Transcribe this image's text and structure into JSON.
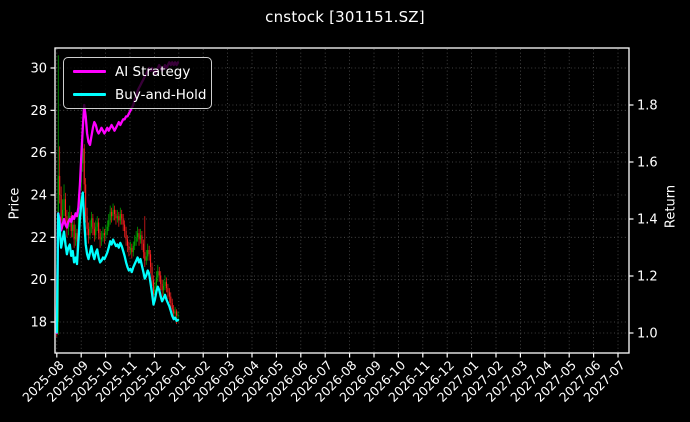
{
  "chart_data": {
    "type": "candlestick_with_lines",
    "title": "cnstock [301151.SZ]",
    "x_axis": {
      "tick_labels": [
        "2025-08",
        "2025-09",
        "2025-10",
        "2025-11",
        "2025-12",
        "2026-01",
        "2026-02",
        "2026-03",
        "2026-04",
        "2026-05",
        "2026-06",
        "2026-07",
        "2026-08",
        "2026-09",
        "2026-10",
        "2026-11",
        "2026-12",
        "2027-01",
        "2027-02",
        "2027-03",
        "2027-04",
        "2027-05",
        "2027-06",
        "2027-07"
      ],
      "label_rotation_deg": 45,
      "data_span": [
        "2025-08",
        "2026-01"
      ]
    },
    "y_left": {
      "label": "Price",
      "ticks": [
        30,
        28,
        26,
        24,
        22,
        20,
        18
      ],
      "range_approx": [
        16.5,
        31.0
      ]
    },
    "y_right": {
      "label": "Return",
      "ticks": [
        "1.8",
        "1.6",
        "1.4",
        "1.2",
        "1.0"
      ],
      "tick_values": [
        1.8,
        1.6,
        1.4,
        1.2,
        1.0
      ],
      "range_approx": [
        0.93,
        2.01
      ]
    },
    "legend": {
      "position": "upper-left",
      "items": [
        {
          "label": "AI Strategy",
          "color": "#ff00ff"
        },
        {
          "label": "Buy-and-Hold",
          "color": "#00ffff"
        }
      ]
    },
    "grid": true,
    "colors": {
      "background": "#000000",
      "text": "#ffffff",
      "spine": "#ffffff",
      "grid": "#999999",
      "candle_up": "#00b000",
      "candle_down": "#ff2020",
      "ai_line": "#ff00ff",
      "bh_line": "#00ffff"
    },
    "bh_base_price": 17.55,
    "candles_ohlc": [
      [
        17.8,
        18.1,
        17.3,
        17.6
      ],
      [
        18.0,
        30.6,
        17.4,
        24.9
      ],
      [
        24.9,
        26.3,
        23.6,
        24.0
      ],
      [
        24.0,
        24.4,
        22.3,
        22.8
      ],
      [
        22.8,
        23.8,
        22.4,
        23.3
      ],
      [
        23.3,
        24.5,
        23.0,
        23.8
      ],
      [
        23.8,
        24.1,
        22.6,
        23.0
      ],
      [
        23.0,
        23.3,
        22.0,
        22.4
      ],
      [
        22.4,
        23.2,
        22.1,
        22.8
      ],
      [
        22.8,
        23.5,
        22.5,
        23.0
      ],
      [
        23.0,
        23.2,
        22.0,
        22.3
      ],
      [
        22.3,
        22.9,
        22.0,
        22.6
      ],
      [
        22.6,
        22.8,
        21.5,
        21.9
      ],
      [
        21.9,
        22.6,
        21.6,
        22.2
      ],
      [
        22.2,
        22.4,
        21.3,
        21.8
      ],
      [
        21.8,
        23.5,
        21.7,
        23.2
      ],
      [
        23.2,
        24.9,
        23.0,
        24.6
      ],
      [
        24.6,
        25.9,
        24.2,
        25.5
      ],
      [
        25.5,
        26.8,
        25.1,
        26.2
      ],
      [
        26.2,
        26.4,
        24.1,
        24.5
      ],
      [
        24.5,
        24.8,
        22.7,
        23.0
      ],
      [
        23.0,
        23.4,
        22.1,
        22.4
      ],
      [
        22.4,
        22.7,
        21.7,
        22.1
      ],
      [
        22.1,
        22.8,
        21.9,
        22.5
      ],
      [
        22.5,
        23.2,
        22.2,
        22.9
      ],
      [
        22.9,
        23.1,
        22.1,
        22.4
      ],
      [
        22.4,
        22.7,
        21.8,
        22.1
      ],
      [
        22.1,
        22.8,
        21.9,
        22.5
      ],
      [
        22.5,
        23.0,
        22.3,
        22.7
      ],
      [
        22.7,
        22.9,
        21.9,
        22.2
      ],
      [
        22.2,
        22.4,
        21.5,
        21.9
      ],
      [
        21.9,
        22.3,
        21.6,
        22.0
      ],
      [
        22.0,
        22.5,
        21.8,
        22.2
      ],
      [
        22.2,
        22.4,
        21.7,
        22.1
      ],
      [
        22.1,
        22.6,
        21.9,
        22.3
      ],
      [
        22.3,
        22.8,
        22.1,
        22.5
      ],
      [
        22.5,
        23.1,
        22.3,
        22.8
      ],
      [
        22.8,
        23.5,
        22.6,
        23.2
      ],
      [
        23.2,
        23.4,
        22.7,
        23.0
      ],
      [
        23.0,
        23.6,
        22.8,
        23.3
      ],
      [
        23.3,
        23.5,
        22.8,
        23.1
      ],
      [
        23.1,
        23.3,
        22.6,
        22.9
      ],
      [
        22.9,
        23.3,
        22.7,
        23.0
      ],
      [
        23.0,
        23.2,
        22.5,
        22.8
      ],
      [
        22.8,
        23.4,
        22.6,
        23.1
      ],
      [
        23.1,
        23.3,
        22.6,
        22.9
      ],
      [
        22.9,
        23.1,
        22.3,
        22.6
      ],
      [
        22.6,
        22.8,
        22.0,
        22.3
      ],
      [
        22.3,
        22.5,
        21.6,
        21.9
      ],
      [
        21.9,
        22.1,
        21.3,
        21.6
      ],
      [
        21.6,
        21.8,
        21.1,
        21.4
      ],
      [
        21.4,
        21.8,
        21.2,
        21.5
      ],
      [
        21.5,
        21.7,
        21.0,
        21.3
      ],
      [
        21.3,
        21.8,
        21.1,
        21.6
      ],
      [
        21.6,
        22.1,
        21.4,
        21.8
      ],
      [
        21.8,
        22.3,
        21.6,
        22.0
      ],
      [
        22.0,
        22.5,
        21.8,
        22.2
      ],
      [
        22.2,
        22.4,
        21.6,
        21.9
      ],
      [
        21.9,
        22.4,
        21.7,
        22.1
      ],
      [
        22.1,
        22.3,
        21.4,
        21.7
      ],
      [
        21.7,
        21.9,
        21.0,
        21.3
      ],
      [
        21.3,
        23.0,
        20.6,
        20.9
      ],
      [
        20.9,
        21.4,
        20.7,
        21.1
      ],
      [
        21.1,
        21.7,
        20.9,
        21.4
      ],
      [
        21.4,
        21.6,
        20.9,
        21.2
      ],
      [
        21.2,
        21.4,
        20.3,
        20.6
      ],
      [
        20.6,
        20.8,
        19.7,
        20.0
      ],
      [
        20.0,
        20.2,
        19.0,
        19.3
      ],
      [
        19.3,
        19.9,
        19.1,
        19.6
      ],
      [
        19.6,
        20.4,
        19.4,
        20.1
      ],
      [
        20.1,
        20.7,
        19.9,
        20.4
      ],
      [
        20.4,
        20.6,
        19.9,
        20.2
      ],
      [
        20.2,
        20.4,
        19.5,
        19.8
      ],
      [
        19.8,
        20.0,
        19.2,
        19.5
      ],
      [
        19.5,
        20.0,
        19.3,
        19.7
      ],
      [
        19.7,
        20.2,
        19.5,
        19.9
      ],
      [
        19.9,
        20.1,
        19.4,
        19.6
      ],
      [
        19.6,
        19.8,
        19.1,
        19.4
      ],
      [
        19.4,
        19.6,
        18.9,
        19.2
      ],
      [
        19.2,
        19.4,
        18.6,
        18.9
      ],
      [
        18.9,
        19.1,
        18.3,
        18.6
      ],
      [
        18.6,
        18.8,
        18.1,
        18.4
      ],
      [
        18.4,
        18.7,
        18.2,
        18.5
      ],
      [
        18.5,
        18.6,
        17.9,
        18.3
      ],
      [
        18.3,
        18.5,
        18.0,
        18.35
      ]
    ],
    "ai_return": [
      1.0,
      1.42,
      1.4,
      1.36,
      1.38,
      1.4,
      1.38,
      1.37,
      1.39,
      1.4,
      1.39,
      1.41,
      1.4,
      1.42,
      1.41,
      1.44,
      1.52,
      1.62,
      1.72,
      1.8,
      1.76,
      1.7,
      1.67,
      1.66,
      1.69,
      1.72,
      1.74,
      1.73,
      1.71,
      1.7,
      1.71,
      1.72,
      1.71,
      1.7,
      1.71,
      1.72,
      1.71,
      1.72,
      1.73,
      1.72,
      1.71,
      1.72,
      1.73,
      1.74,
      1.73,
      1.74,
      1.75,
      1.75,
      1.76,
      1.76,
      1.77,
      1.78,
      1.79,
      1.8,
      1.82,
      1.83,
      1.85,
      1.86,
      1.87,
      1.88,
      1.89,
      1.9,
      1.91,
      1.92,
      1.93,
      1.92,
      1.93,
      1.92,
      1.91,
      1.92,
      1.93,
      1.94,
      1.93,
      1.92,
      1.93,
      1.94,
      1.93,
      1.94,
      1.95,
      1.94,
      1.95,
      1.94,
      1.95,
      1.94,
      1.95
    ]
  }
}
